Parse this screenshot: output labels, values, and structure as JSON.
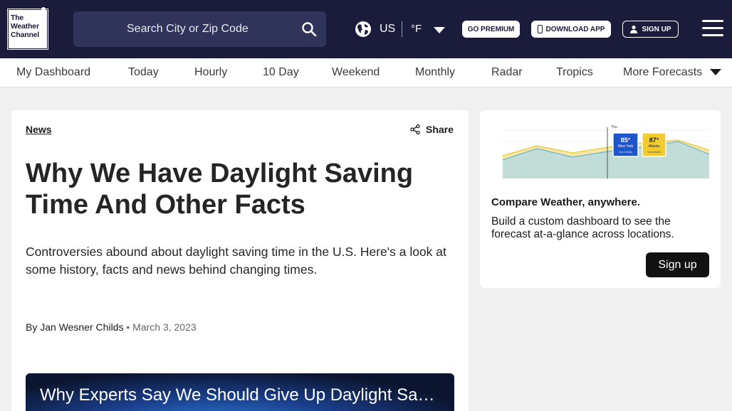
{
  "header": {
    "logo_lines": [
      "The",
      "Weather",
      "Channel"
    ],
    "search_placeholder": "Search City or Zip Code",
    "country": "US",
    "unit": "°F",
    "premium_label": "GO PREMIUM",
    "download_label": "DOWNLOAD APP",
    "signup_label": "SIGN UP"
  },
  "nav": {
    "items": [
      "My Dashboard",
      "Today",
      "Hourly",
      "10 Day",
      "Weekend",
      "Monthly",
      "Radar",
      "Tropics",
      "More Forecasts"
    ]
  },
  "article": {
    "section": "News",
    "share_label": "Share",
    "headline": "Why We Have Daylight Saving Time And Other Facts",
    "subhead": "Controversies abound about daylight saving time in the U.S. Here's a look at some history, facts and news behind changing times.",
    "author": "By Jan Wesner Childs",
    "date": "March 3, 2023",
    "video_title": "Why Experts Say We Should Give Up Daylight Saving Time"
  },
  "promo": {
    "title": "Compare Weather, anywhere.",
    "description": "Build a custom dashboard to see the forecast at-a-glance across locations.",
    "button_label": "Sign up",
    "graph_day": "Thu",
    "graph_cards": [
      {
        "temp": "85°",
        "city": "New York",
        "link": "See Details"
      },
      {
        "temp": "87°",
        "city": "Atlanta",
        "link": "See Details"
      }
    ]
  },
  "colors": {
    "header_bg": "#1b1b3b",
    "search_bg": "#31345a",
    "card_blue": "#1f55c8",
    "card_yellow": "#f2cc2e"
  }
}
